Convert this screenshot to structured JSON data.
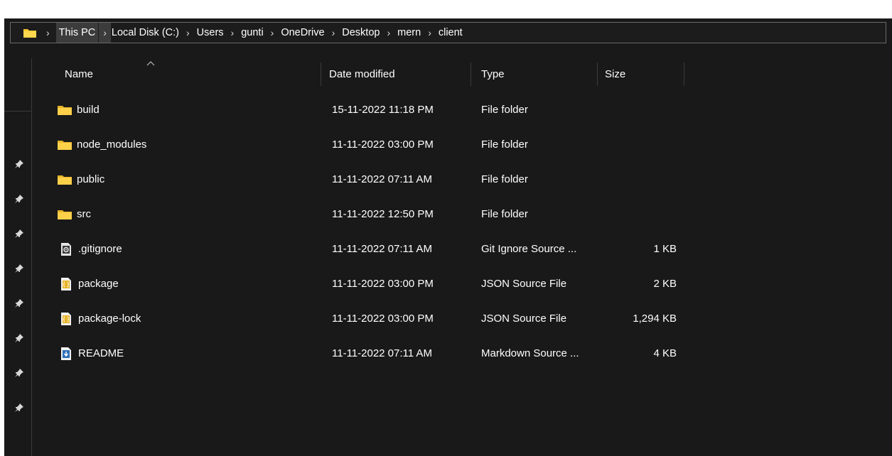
{
  "address": {
    "crumbs": [
      {
        "label": "This PC",
        "active": true
      },
      {
        "label": "Local Disk (C:)"
      },
      {
        "label": "Users"
      },
      {
        "label": "gunti"
      },
      {
        "label": "OneDrive"
      },
      {
        "label": "Desktop"
      },
      {
        "label": "mern"
      },
      {
        "label": "client"
      }
    ],
    "separator": "›"
  },
  "columns": {
    "name": "Name",
    "date": "Date modified",
    "type": "Type",
    "size": "Size"
  },
  "files": [
    {
      "name": "build",
      "date": "15-11-2022 11:18 PM",
      "type": "File folder",
      "size": "",
      "icon": "folder-icon"
    },
    {
      "name": "node_modules",
      "date": "11-11-2022 03:00 PM",
      "type": "File folder",
      "size": "",
      "icon": "folder-icon"
    },
    {
      "name": "public",
      "date": "11-11-2022 07:11 AM",
      "type": "File folder",
      "size": "",
      "icon": "folder-icon"
    },
    {
      "name": "src",
      "date": "11-11-2022 12:50 PM",
      "type": "File folder",
      "size": "",
      "icon": "folder-icon"
    },
    {
      "name": ".gitignore",
      "date": "11-11-2022 07:11 AM",
      "type": "Git Ignore Source ...",
      "size": "1 KB",
      "icon": "gitignore-file-icon"
    },
    {
      "name": "package",
      "date": "11-11-2022 03:00 PM",
      "type": "JSON Source File",
      "size": "2 KB",
      "icon": "json-file-icon"
    },
    {
      "name": "package-lock",
      "date": "11-11-2022 03:00 PM",
      "type": "JSON Source File",
      "size": "1,294 KB",
      "icon": "json-file-icon"
    },
    {
      "name": "README",
      "date": "11-11-2022 07:11 AM",
      "type": "Markdown Source ...",
      "size": "4 KB",
      "icon": "markdown-file-icon"
    }
  ],
  "colors": {
    "background": "#191919",
    "folder": "#f8c72e",
    "text": "#ffffff"
  }
}
